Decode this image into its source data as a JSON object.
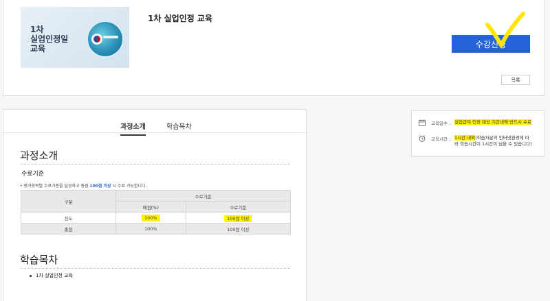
{
  "course": {
    "thumbnail_text": [
      "1차",
      "실업인정일",
      "교육"
    ],
    "title": "1차 실업인정 교육",
    "apply_label": "수강신청",
    "list_label": "목록"
  },
  "tabs": [
    {
      "label": "과정소개",
      "active": true
    },
    {
      "label": "학습목차",
      "active": false
    }
  ],
  "intro": {
    "heading": "과정소개",
    "criteria_label": "수료기준",
    "note_prefix": "• 평가항목별 수료기준을 달성하고 총점 ",
    "note_highlight": "100점 이상",
    "note_suffix": " 시 수료 가능합니다.",
    "table": {
      "col_category": "구분",
      "col_criteria": "수료기준",
      "col_weight": "배점(%)",
      "col_standard": "수료기준",
      "rows": [
        {
          "category": "진도",
          "weight": "100%",
          "standard": "100점 이상",
          "highlight": true
        },
        {
          "category": "총점",
          "weight": "100%",
          "standard": "100점 이상",
          "highlight": false
        }
      ]
    }
  },
  "toc": {
    "heading": "학습목차",
    "items": [
      "1차 실업인정 교육"
    ]
  },
  "info": {
    "period_label": "교육일수 :",
    "period_value": "실업급여 인정 대상 기간내에 반드시 수료",
    "time_label": "교육시간 :",
    "time_highlight": "1시간 내외",
    "time_rest_1": "(학습자분의 인터넷환경에 따",
    "time_rest_2": "라 학습시간이 1시간이 넘을 수 있습니다)"
  },
  "colors": {
    "accent": "#2463d8",
    "highlight": "#fff200"
  }
}
